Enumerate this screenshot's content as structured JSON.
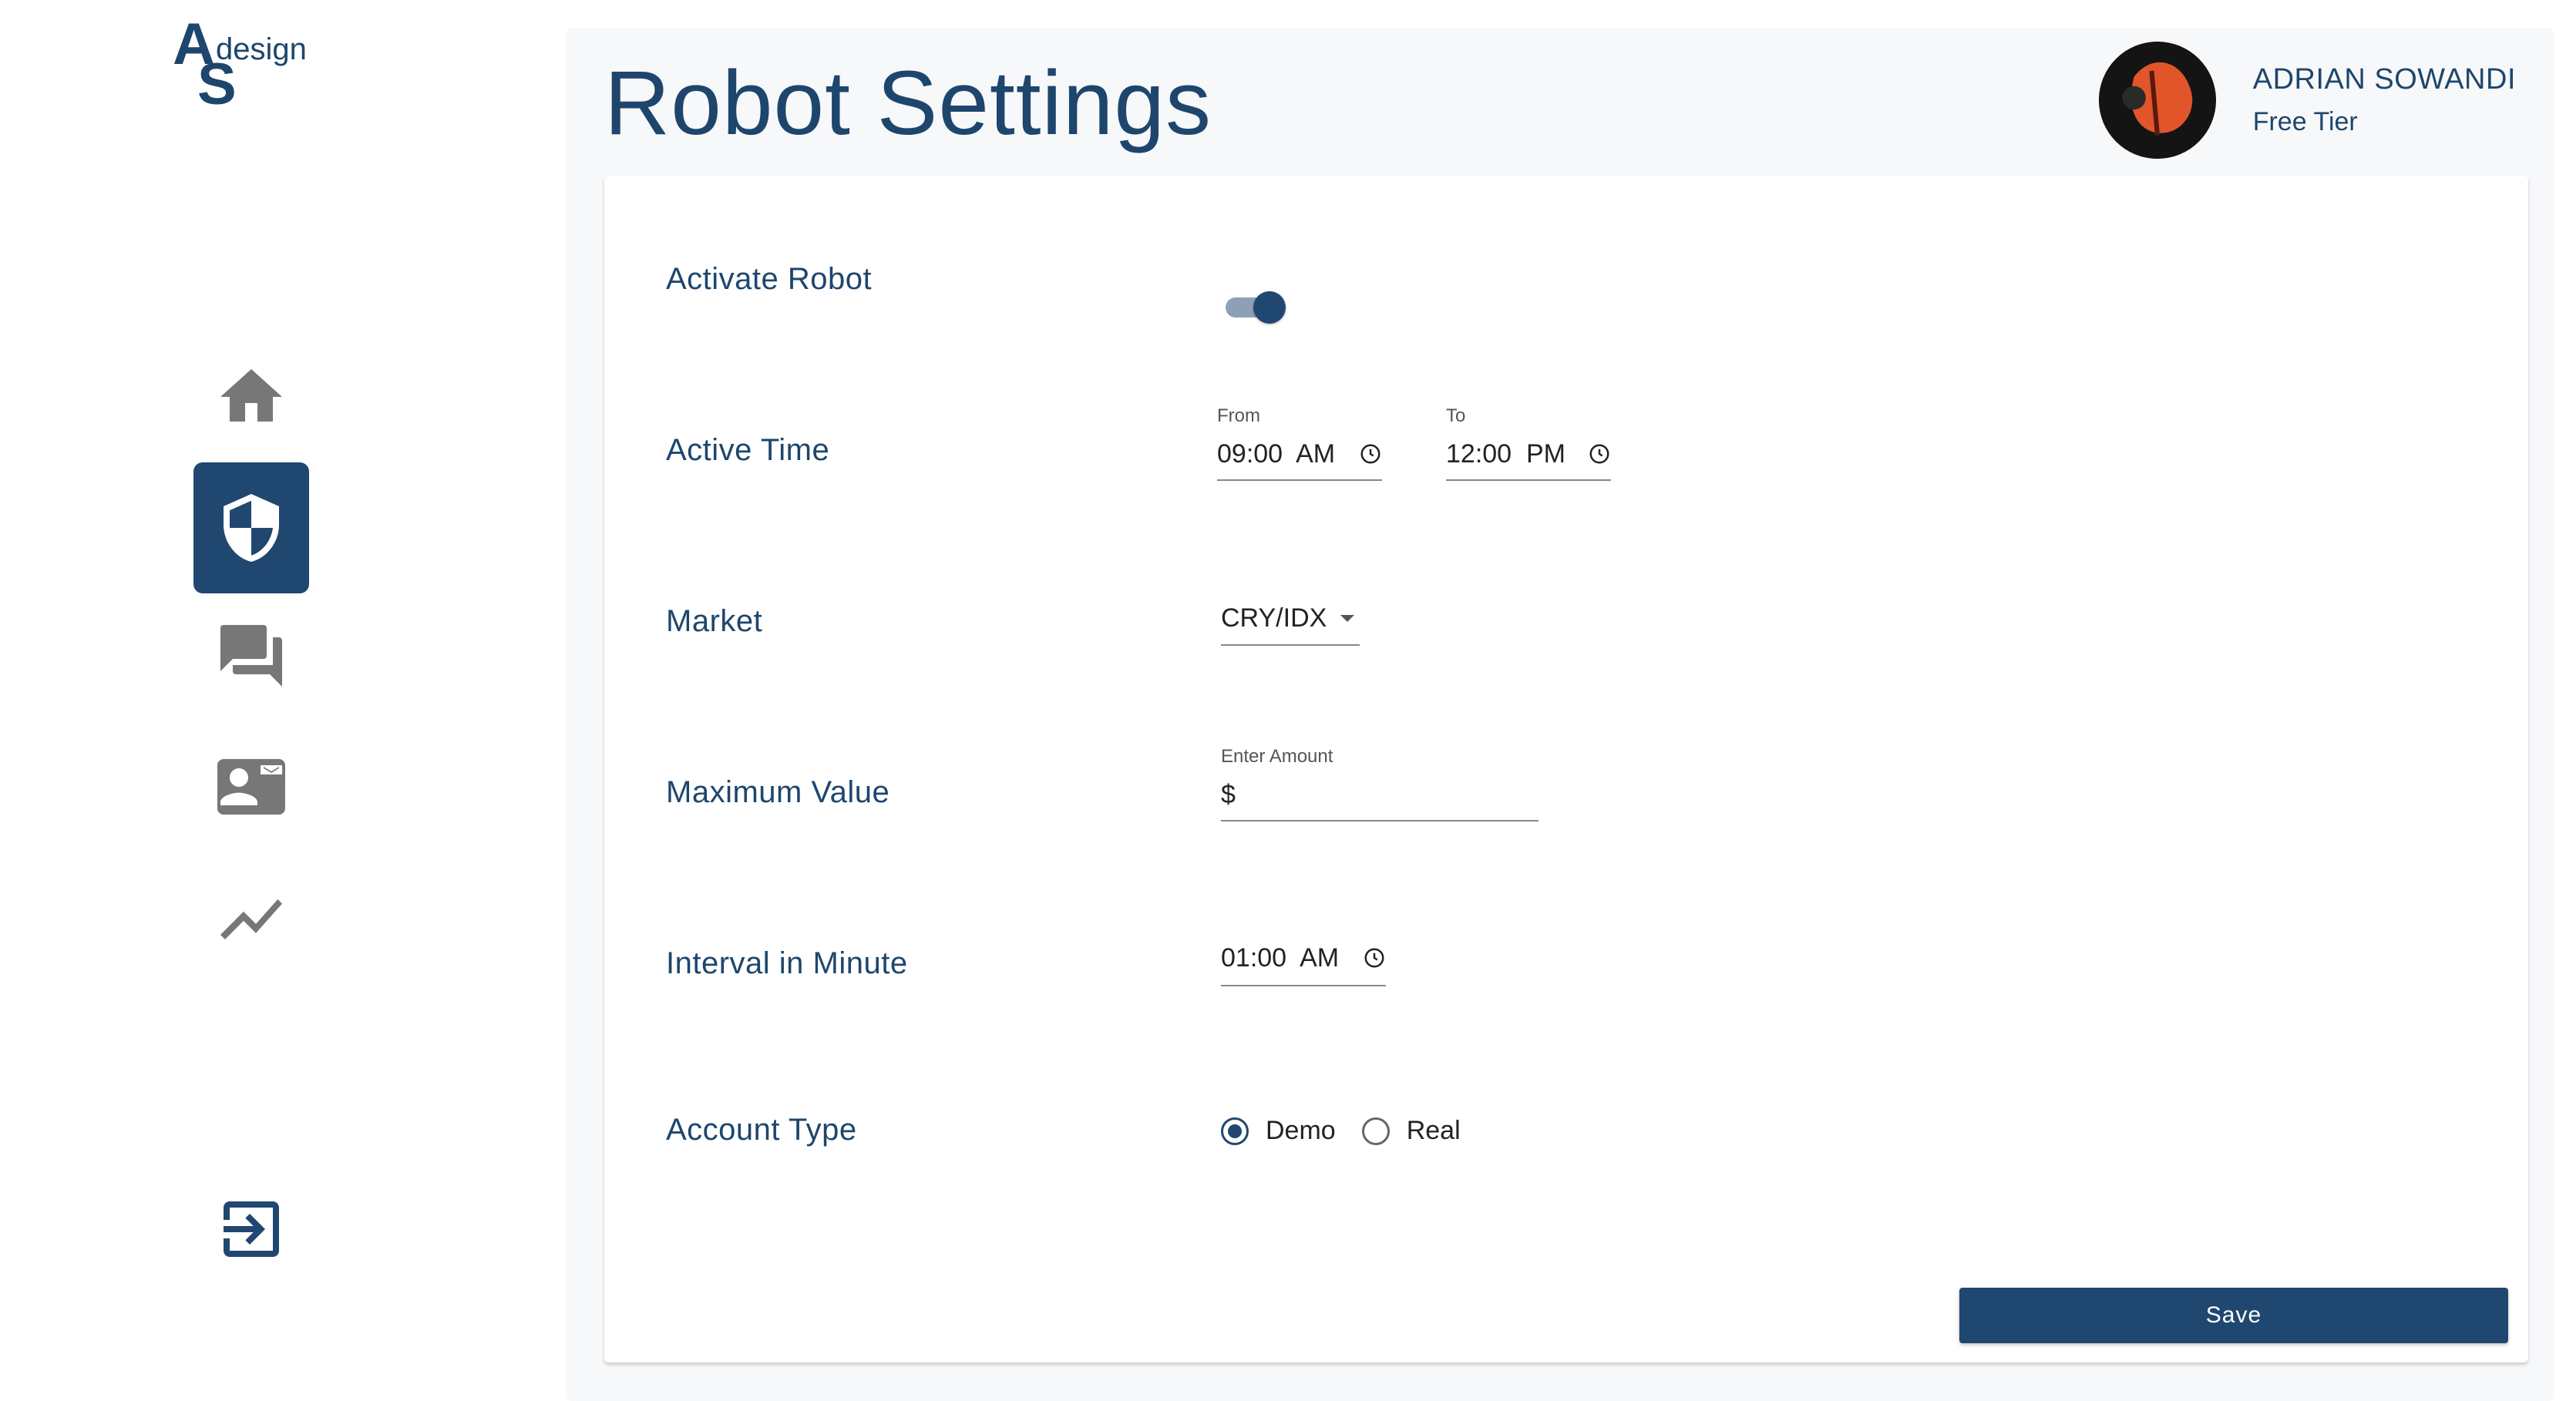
{
  "logo": {
    "letter_a": "A",
    "letter_s": "S",
    "word": "design"
  },
  "sidebar": {
    "items": [
      {
        "icon": "home-icon",
        "active": false
      },
      {
        "icon": "shield-icon",
        "active": true
      },
      {
        "icon": "chat-icon",
        "active": false
      },
      {
        "icon": "contact-card-icon",
        "active": false
      },
      {
        "icon": "trend-chart-icon",
        "active": false
      }
    ],
    "logout_icon": "logout-icon",
    "active_color": "#1f4770"
  },
  "header": {
    "title": "Robot Settings",
    "user": {
      "name": "ADRIAN SOWANDI",
      "tier": "Free Tier"
    }
  },
  "form": {
    "activate_robot": {
      "label": "Activate Robot",
      "enabled": true
    },
    "active_time": {
      "label": "Active Time",
      "from_label": "From",
      "from_value": "09:00  AM",
      "to_label": "To",
      "to_value": "12:00  PM"
    },
    "market": {
      "label": "Market",
      "value": "CRY/IDX"
    },
    "maximum_value": {
      "label": "Maximum Value",
      "field_label": "Enter Amount",
      "prefix": "$",
      "value": ""
    },
    "interval": {
      "label": "Interval in Minute",
      "value": "01:00  AM"
    },
    "account_type": {
      "label": "Account Type",
      "options": [
        {
          "label": "Demo",
          "checked": true
        },
        {
          "label": "Real",
          "checked": false
        }
      ]
    },
    "save_label": "Save"
  },
  "colors": {
    "primary": "#1f4770",
    "text": "#1e466d",
    "panel_bg": "#f7f8fa"
  }
}
